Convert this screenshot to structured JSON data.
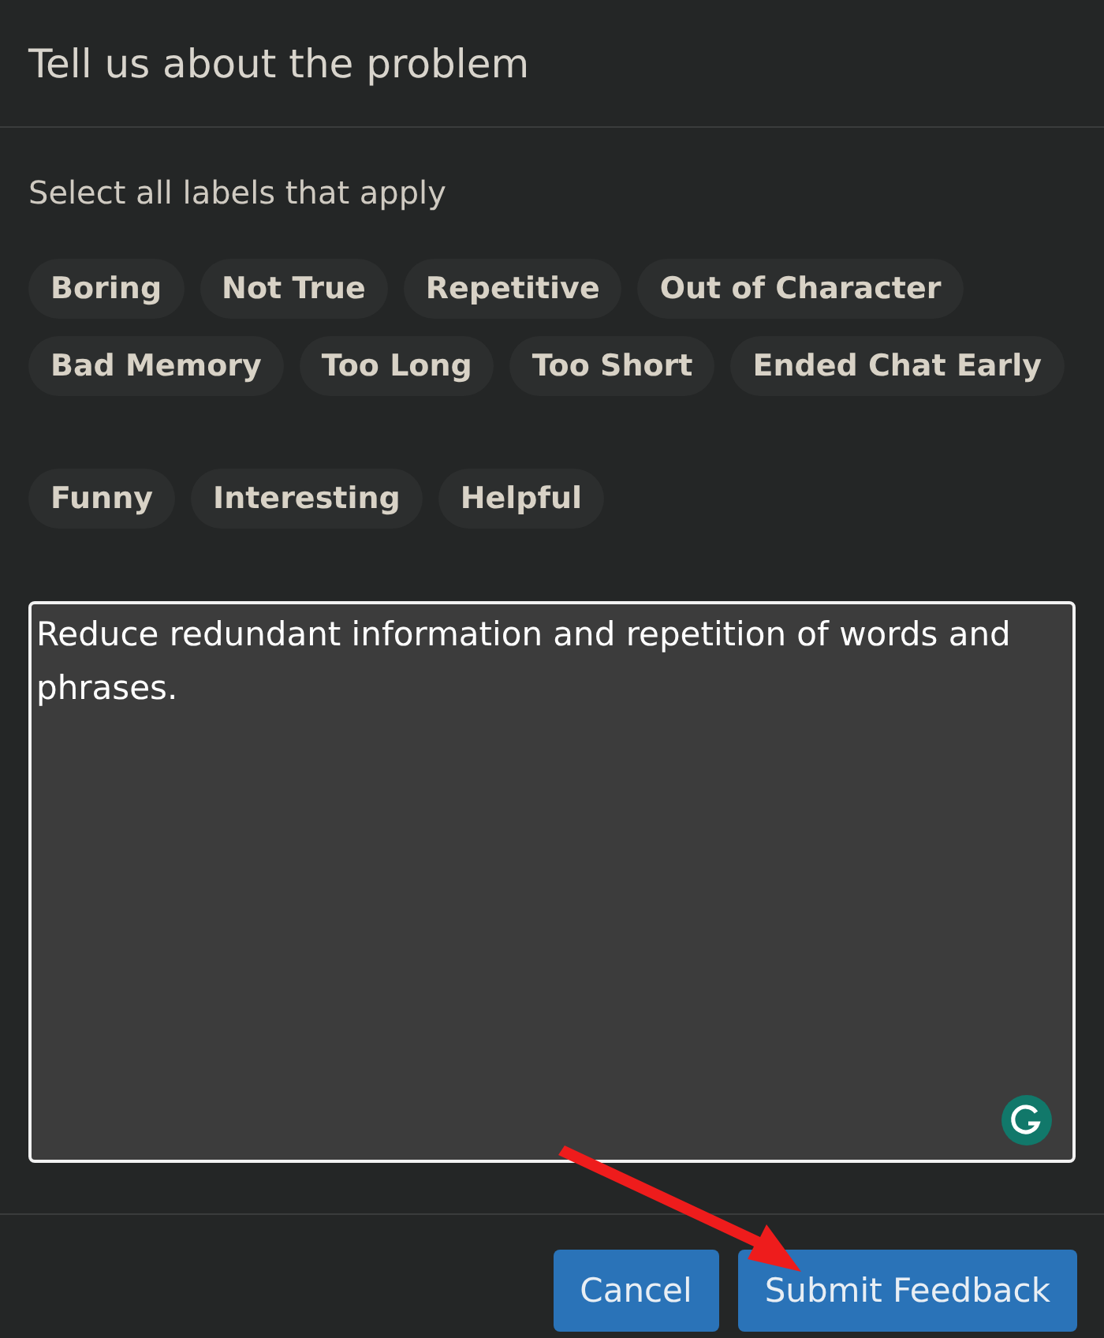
{
  "dialog": {
    "title": "Tell us about the problem"
  },
  "instructions": "Select all labels that apply",
  "label_groups": [
    {
      "labels": [
        {
          "label": "Boring",
          "selected": false
        },
        {
          "label": "Not True",
          "selected": false
        },
        {
          "label": "Repetitive",
          "selected": false
        },
        {
          "label": "Out of Character",
          "selected": false
        },
        {
          "label": "Bad Memory",
          "selected": false
        },
        {
          "label": "Too Long",
          "selected": false
        },
        {
          "label": "Too Short",
          "selected": false
        },
        {
          "label": "Ended Chat Early",
          "selected": false
        }
      ]
    },
    {
      "labels": [
        {
          "label": "Funny",
          "selected": false
        },
        {
          "label": "Interesting",
          "selected": false
        },
        {
          "label": "Helpful",
          "selected": false
        }
      ]
    }
  ],
  "feedback": {
    "value": "Reduce redundant information and repetition of words and phrases."
  },
  "buttons": [
    {
      "label": "Cancel"
    },
    {
      "label": "Submit Feedback"
    }
  ]
}
